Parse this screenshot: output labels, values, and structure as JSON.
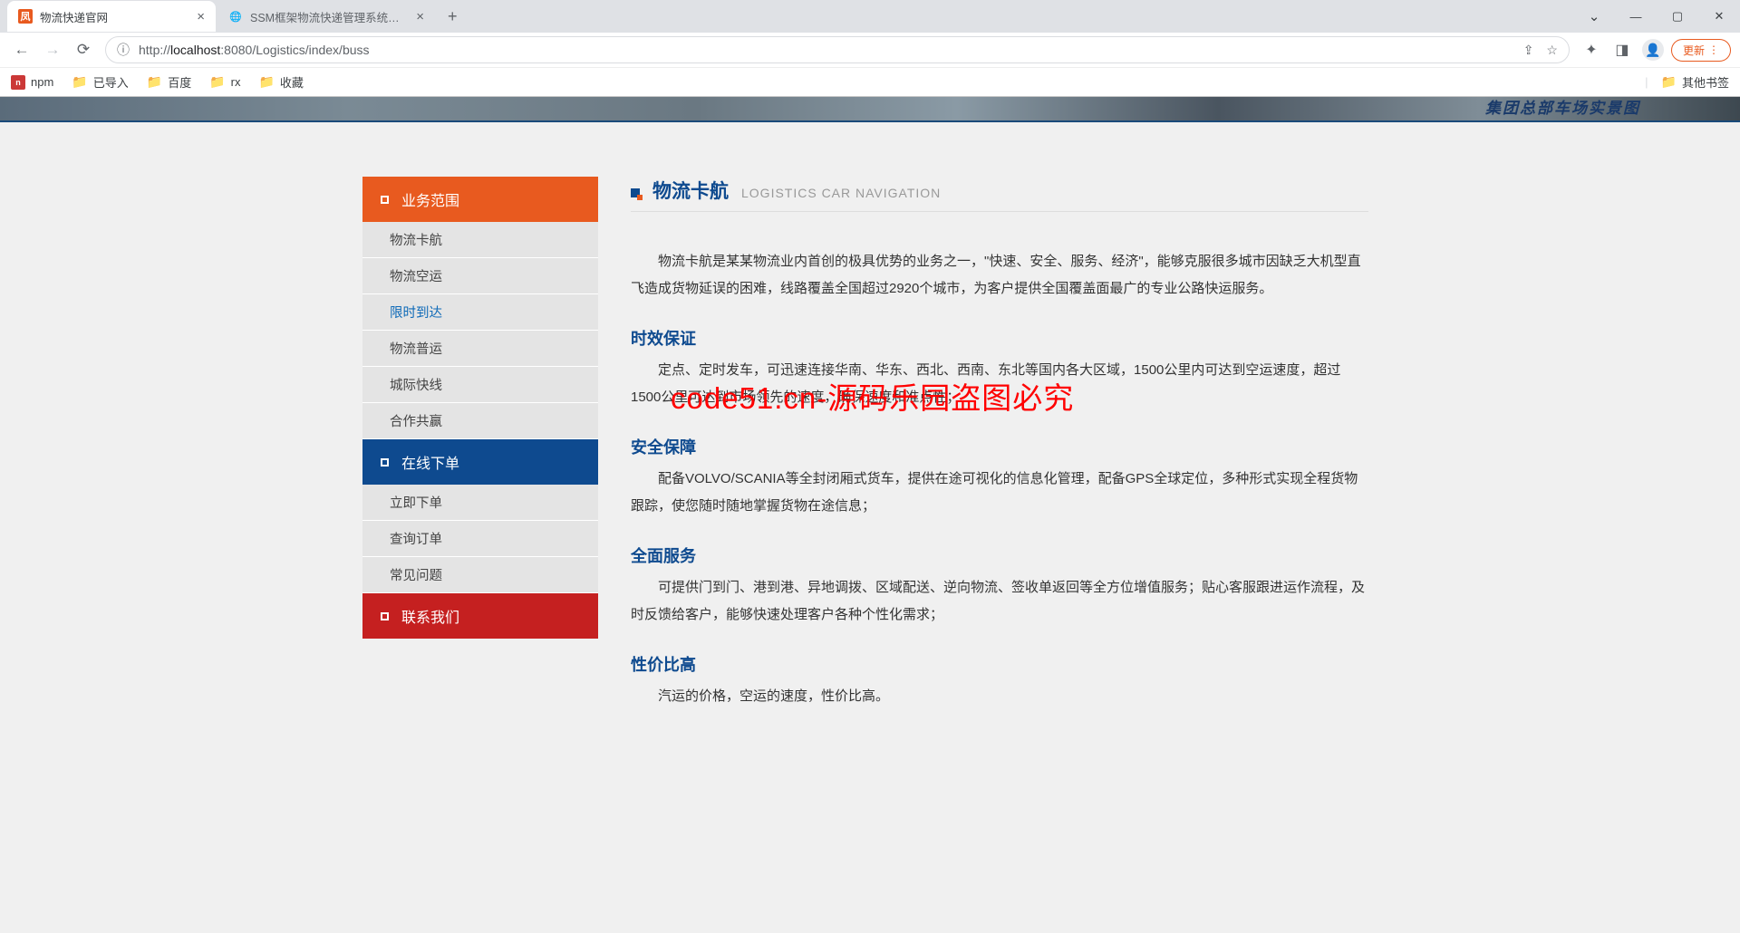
{
  "browser": {
    "tabs": [
      {
        "title": "物流快递官网",
        "favicon": "凤",
        "active": true
      },
      {
        "title": "SSM框架物流快递管理系统后台",
        "favicon": "globe",
        "active": false
      }
    ],
    "url": {
      "proto": "http://",
      "host": "localhost",
      "port": ":8080",
      "path": "/Logistics/index/buss"
    },
    "update_label": "更新",
    "bookmarks": [
      {
        "label": "npm",
        "icon": "npm"
      },
      {
        "label": "已导入",
        "icon": "folder"
      },
      {
        "label": "百度",
        "icon": "folder"
      },
      {
        "label": "rx",
        "icon": "folder"
      },
      {
        "label": "收藏",
        "icon": "folder"
      }
    ],
    "other_bookmarks": "其他书签"
  },
  "banner": {
    "caption": "集团总部车场实景图"
  },
  "sidebar": {
    "sections": [
      {
        "title": "业务范围",
        "color": "orange",
        "items": [
          {
            "label": "物流卡航"
          },
          {
            "label": "物流空运"
          },
          {
            "label": "限时到达",
            "active": true
          },
          {
            "label": "物流普运"
          },
          {
            "label": "城际快线"
          },
          {
            "label": "合作共赢"
          }
        ]
      },
      {
        "title": "在线下单",
        "color": "blue",
        "items": [
          {
            "label": "立即下单"
          },
          {
            "label": "查询订单"
          },
          {
            "label": "常见问题"
          }
        ]
      },
      {
        "title": "联系我们",
        "color": "red",
        "items": []
      }
    ]
  },
  "main": {
    "title_cn": "物流卡航",
    "title_en": "LOGISTICS CAR NAVIGATION",
    "intro": "物流卡航是某某物流业内首创的极具优势的业务之一，\"快速、安全、服务、经济\"，能够克服很多城市因缺乏大机型直飞造成货物延误的困难，线路覆盖全国超过2920个城市，为客户提供全国覆盖面最广的专业公路快运服务。",
    "sections": [
      {
        "heading": "时效保证",
        "body": "定点、定时发车，可迅速连接华南、华东、西北、西南、东北等国内各大区域，1500公里内可达到空运速度，超过1500公里可达到市场领先的速度，确保速度和准点性；"
      },
      {
        "heading": "安全保障",
        "body": "配备VOLVO/SCANIA等全封闭厢式货车，提供在途可视化的信息化管理，配备GPS全球定位，多种形式实现全程货物跟踪，使您随时随地掌握货物在途信息；"
      },
      {
        "heading": "全面服务",
        "body": "可提供门到门、港到港、异地调拨、区域配送、逆向物流、签收单返回等全方位增值服务；贴心客服跟进运作流程，及时反馈给客户，能够快速处理客户各种个性化需求；"
      },
      {
        "heading": "性价比高",
        "body": "汽运的价格，空运的速度，性价比高。"
      }
    ],
    "watermark": "code51.cn-源码乐园盗图必究"
  }
}
